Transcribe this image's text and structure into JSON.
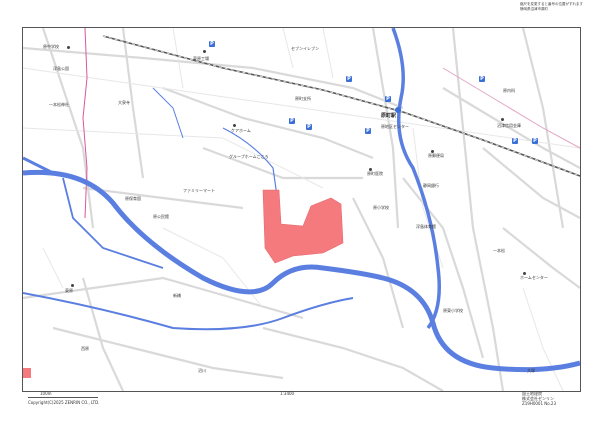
{
  "header": {
    "line1": "縮尺を変更すると番号の位置がずれます",
    "line2": "静岡県沼津市原町"
  },
  "map": {
    "labels": {
      "station": "原町駅",
      "school1": "原中学校",
      "school2": "原小学校",
      "school3": "原東小学校",
      "park": "浮島公園",
      "shrine": "一本松神社",
      "temple": "大泉寺",
      "hall": "原地区センター",
      "post": "原郵便局",
      "clinic": "原町医院",
      "apartment": "ファミリーマート",
      "store": "グループホームこころ",
      "gym": "浮島体育館",
      "kindergarten": "原保育園",
      "factory": "東原工場",
      "river": "沼川",
      "office1": "沼津信用金庫",
      "office2": "原町支所",
      "hotel": "ケアホーム",
      "mart": "セブンイレブン",
      "bank": "静岡銀行",
      "plaza": "原公民館",
      "bridge": "新橋",
      "clinic2": "原内科",
      "shop2": "ホームセンター",
      "area1": "東原",
      "area2": "西原",
      "area3": "一本松",
      "area4": "大塚"
    },
    "parking_symbol": "P",
    "highlight_color": "#f47a7e",
    "water_color": "#5b7fe0",
    "road_color": "#d9d9d9",
    "rail_color": "#c2a0c8"
  },
  "footer": {
    "scale_left": "100m",
    "scale_right": "1:3400",
    "copyright": "Copyright(C)2025 ZENRIN CO., LTD.",
    "right1": "国土地理院",
    "right2": "株式会社ゼンリン",
    "right3": "Z19H0001 No.23"
  }
}
